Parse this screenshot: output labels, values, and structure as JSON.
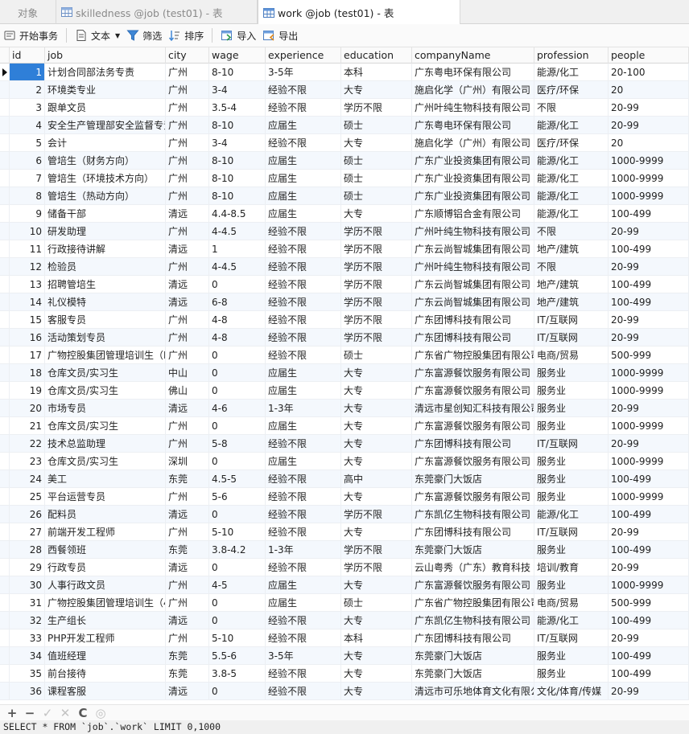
{
  "tabs": [
    {
      "label": "对象"
    },
    {
      "label": "skilledness @job (test01) - 表"
    },
    {
      "label": "work @job (test01) - 表"
    }
  ],
  "toolbar": {
    "begin_transaction": "开始事务",
    "text": "文本",
    "filter": "筛选",
    "sort": "排序",
    "import": "导入",
    "export": "导出"
  },
  "columns": [
    "id",
    "job",
    "city",
    "wage",
    "experience",
    "education",
    "companyName",
    "profession",
    "people"
  ],
  "rows": [
    [
      "1",
      "计划合同部法务专责",
      "广州",
      "8-10",
      "3-5年",
      "本科",
      "广东粤电环保有限公司",
      "能源/化工",
      "20-100"
    ],
    [
      "2",
      "环境类专业",
      "广州",
      "3-4",
      "经验不限",
      "大专",
      "施启化学（广州）有限公司",
      "医疗/环保",
      "20"
    ],
    [
      "3",
      "跟单文员",
      "广州",
      "3.5-4",
      "经验不限",
      "学历不限",
      "广州叶纯生物科技有限公司",
      "不限",
      "20-99"
    ],
    [
      "4",
      "安全生产管理部安全监督专责",
      "广州",
      "8-10",
      "应届生",
      "硕士",
      "广东粤电环保有限公司",
      "能源/化工",
      "20-99"
    ],
    [
      "5",
      "会计",
      "广州",
      "3-4",
      "经验不限",
      "大专",
      "施启化学（广州）有限公司",
      "医疗/环保",
      "20"
    ],
    [
      "6",
      "管培生（财务方向）",
      "广州",
      "8-10",
      "应届生",
      "硕士",
      "广东广业投资集团有限公司",
      "能源/化工",
      "1000-9999"
    ],
    [
      "7",
      "管培生（环境技术方向）",
      "广州",
      "8-10",
      "应届生",
      "硕士",
      "广东广业投资集团有限公司",
      "能源/化工",
      "1000-9999"
    ],
    [
      "8",
      "管培生（热动方向）",
      "广州",
      "8-10",
      "应届生",
      "硕士",
      "广东广业投资集团有限公司",
      "能源/化工",
      "1000-9999"
    ],
    [
      "9",
      "储备干部",
      "清远",
      "4.4-8.5",
      "应届生",
      "大专",
      "广东顺博铝合金有限公司",
      "能源/化工",
      "100-499"
    ],
    [
      "10",
      "研发助理",
      "广州",
      "4-4.5",
      "经验不限",
      "学历不限",
      "广州叶纯生物科技有限公司",
      "不限",
      "20-99"
    ],
    [
      "11",
      "行政接待讲解",
      "清远",
      "1",
      "经验不限",
      "学历不限",
      "广东云尚智城集团有限公司",
      "地产/建筑",
      "100-499"
    ],
    [
      "12",
      "检验员",
      "广州",
      "4-4.5",
      "经验不限",
      "学历不限",
      "广州叶纯生物科技有限公司",
      "不限",
      "20-99"
    ],
    [
      "13",
      "招聘管培生",
      "清远",
      "0",
      "经验不限",
      "学历不限",
      "广东云尚智城集团有限公司",
      "地产/建筑",
      "100-499"
    ],
    [
      "14",
      "礼仪模特",
      "清远",
      "6-8",
      "经验不限",
      "学历不限",
      "广东云尚智城集团有限公司",
      "地产/建筑",
      "100-499"
    ],
    [
      "15",
      "客服专员",
      "广州",
      "4-8",
      "经验不限",
      "学历不限",
      "广东团博科技有限公司",
      "IT/互联网",
      "20-99"
    ],
    [
      "16",
      "活动策划专员",
      "广州",
      "4-8",
      "经验不限",
      "学历不限",
      "广东团博科技有限公司",
      "IT/互联网",
      "20-99"
    ],
    [
      "17",
      "广物控股集团管理培训生（I",
      "广州",
      "0",
      "经验不限",
      "硕士",
      "广东省广物控股集团有限公司",
      "电商/贸易",
      "500-999"
    ],
    [
      "18",
      "仓库文员/实习生",
      "中山",
      "0",
      "应届生",
      "大专",
      "广东富源餐饮服务有限公司",
      "服务业",
      "1000-9999"
    ],
    [
      "19",
      "仓库文员/实习生",
      "佛山",
      "0",
      "应届生",
      "大专",
      "广东富源餐饮服务有限公司",
      "服务业",
      "1000-9999"
    ],
    [
      "20",
      "市场专员",
      "清远",
      "4-6",
      "1-3年",
      "大专",
      "清远市星创知汇科技有限公司",
      "服务业",
      "20-99"
    ],
    [
      "21",
      "仓库文员/实习生",
      "广州",
      "0",
      "应届生",
      "大专",
      "广东富源餐饮服务有限公司",
      "服务业",
      "1000-9999"
    ],
    [
      "22",
      "技术总监助理",
      "广州",
      "5-8",
      "经验不限",
      "大专",
      "广东团博科技有限公司",
      "IT/互联网",
      "20-99"
    ],
    [
      "23",
      "仓库文员/实习生",
      "深圳",
      "0",
      "应届生",
      "大专",
      "广东富源餐饮服务有限公司",
      "服务业",
      "1000-9999"
    ],
    [
      "24",
      "美工",
      "东莞",
      "4.5-5",
      "经验不限",
      "高中",
      "东莞豪门大饭店",
      "服务业",
      "100-499"
    ],
    [
      "25",
      "平台运营专员",
      "广州",
      "5-6",
      "经验不限",
      "大专",
      "广东富源餐饮服务有限公司",
      "服务业",
      "1000-9999"
    ],
    [
      "26",
      "配料员",
      "清远",
      "0",
      "经验不限",
      "学历不限",
      "广东凯亿生物科技有限公司",
      "能源/化工",
      "100-499"
    ],
    [
      "27",
      "前端开发工程师",
      "广州",
      "5-10",
      "经验不限",
      "大专",
      "广东团博科技有限公司",
      "IT/互联网",
      "20-99"
    ],
    [
      "28",
      "西餐领班",
      "东莞",
      "3.8-4.2",
      "1-3年",
      "学历不限",
      "东莞豪门大饭店",
      "服务业",
      "100-499"
    ],
    [
      "29",
      "行政专员",
      "清远",
      "0",
      "经验不限",
      "学历不限",
      "云山粤秀（广东）教育科技",
      "培训/教育",
      "20-99"
    ],
    [
      "30",
      "人事行政文员",
      "广州",
      "4-5",
      "应届生",
      "大专",
      "广东富源餐饮服务有限公司",
      "服务业",
      "1000-9999"
    ],
    [
      "31",
      "广物控股集团管理培训生（4",
      "广州",
      "0",
      "应届生",
      "硕士",
      "广东省广物控股集团有限公司",
      "电商/贸易",
      "500-999"
    ],
    [
      "32",
      "生产组长",
      "清远",
      "0",
      "经验不限",
      "大专",
      "广东凯亿生物科技有限公司",
      "能源/化工",
      "100-499"
    ],
    [
      "33",
      "PHP开发工程师",
      "广州",
      "5-10",
      "经验不限",
      "本科",
      "广东团博科技有限公司",
      "IT/互联网",
      "20-99"
    ],
    [
      "34",
      "值班经理",
      "东莞",
      "5.5-6",
      "3-5年",
      "大专",
      "东莞豪门大饭店",
      "服务业",
      "100-499"
    ],
    [
      "35",
      "前台接待",
      "东莞",
      "3.8-5",
      "经验不限",
      "大专",
      "东莞豪门大饭店",
      "服务业",
      "100-499"
    ],
    [
      "36",
      "课程客服",
      "清远",
      "0",
      "经验不限",
      "大专",
      "清远市可乐地体育文化有限公",
      "文化/体育/传媒",
      "20-99"
    ]
  ],
  "nav": {
    "add": "+",
    "remove": "−",
    "apply": "✓",
    "discard": "✕",
    "refresh": "C",
    "stop": "◎"
  },
  "status_sql": "SELECT * FROM `job`.`work` LIMIT 0,1000"
}
